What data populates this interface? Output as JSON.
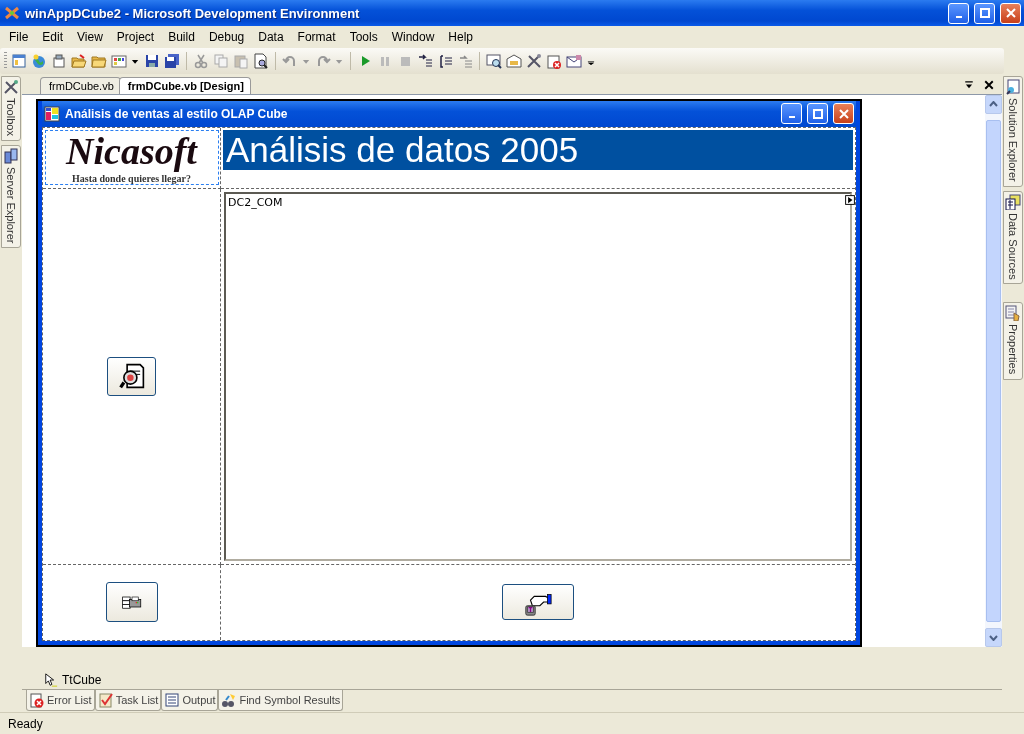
{
  "window": {
    "title": "winAppDCube2 - Microsoft Development Environment"
  },
  "menu": [
    "File",
    "Edit",
    "View",
    "Project",
    "Build",
    "Debug",
    "Data",
    "Format",
    "Tools",
    "Window",
    "Help"
  ],
  "left_dock": [
    "Toolbox",
    "Server Explorer"
  ],
  "document_tabs": [
    {
      "label": "frmDCube.vb",
      "selected": false
    },
    {
      "label": "frmDCube.vb [Design]",
      "selected": true
    }
  ],
  "form": {
    "title": "Análisis de ventas al estilo OLAP Cube",
    "logo": {
      "name": "Nicasoft",
      "tagline": "Hasta donde quieres llegar?"
    },
    "heading": "Análisis de datos 2005",
    "textbox": {
      "value": "DC2_COM"
    }
  },
  "component_tray": [
    "TtCube"
  ],
  "bottom_tabs": [
    "Error List",
    "Task List",
    "Output",
    "Find Symbol Results"
  ],
  "right_dock": [
    "Solution Explorer",
    "Data Sources",
    "Properties"
  ],
  "status_bar": "Ready"
}
